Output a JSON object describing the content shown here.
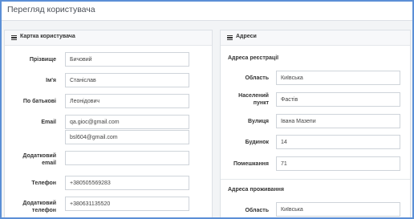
{
  "page": {
    "title": "Перегляд користувача"
  },
  "user_card": {
    "title": "Картка користувача",
    "icon": "list-icon",
    "fields": {
      "last_name": {
        "label": "Прізвище",
        "value": "Бичовий"
      },
      "first_name": {
        "label": "Ім'я",
        "value": "Станіслав"
      },
      "patronymic": {
        "label": "По батькові",
        "value": "Леонідович"
      },
      "email": {
        "label": "Email",
        "value": "qa.gioc@gmail.com",
        "value2": "bsl604@gmail.com"
      },
      "extra_email": {
        "label_line1": "Додатковий",
        "label_line2": "email",
        "value": ""
      },
      "phone": {
        "label": "Телефон",
        "value": "+380505569283"
      },
      "extra_phone": {
        "label_line1": "Додатковий",
        "label_line2": "телефон",
        "value": "+380631135520"
      }
    }
  },
  "addresses": {
    "title": "Адреси",
    "icon": "list-icon",
    "registration": {
      "heading": "Адреса реєстрації",
      "region": {
        "label": "Область",
        "value": "Київська"
      },
      "locality": {
        "label_line1": "Населений",
        "label_line2": "пункт",
        "value": "Фастів"
      },
      "street": {
        "label": "Вулиця",
        "value": "Івана Мазепи"
      },
      "house": {
        "label": "Будинок",
        "value": "14"
      },
      "apartment": {
        "label": "Помешкання",
        "value": "71"
      }
    },
    "residence": {
      "heading": "Адреса проживання",
      "region": {
        "label": "Область",
        "value": "Київська"
      }
    }
  }
}
